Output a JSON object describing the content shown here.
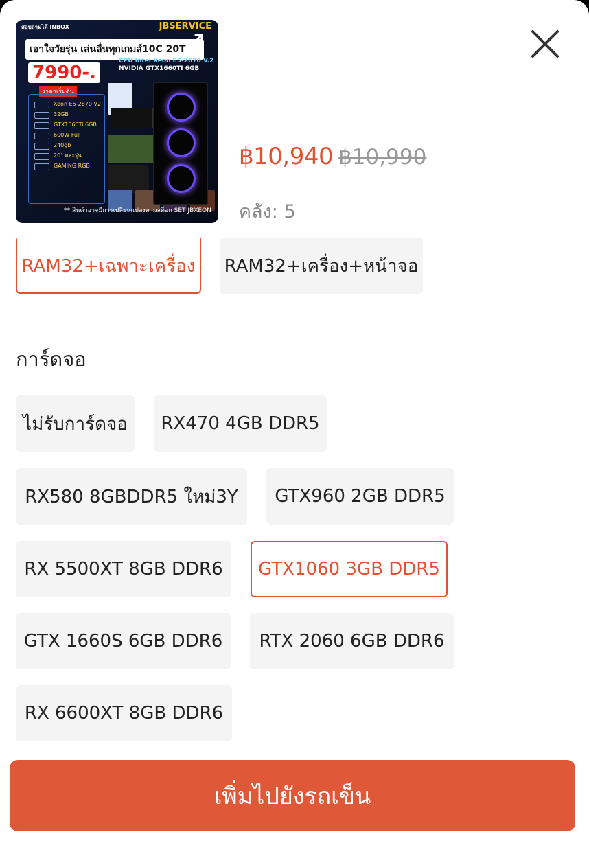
{
  "product": {
    "price": "฿10,940",
    "original_price": "฿10,990",
    "stock_label": "คลัง: 5",
    "image": {
      "top_badge": "สอบถามได้ INBOX",
      "brand": "JBSERVICE",
      "banner_text": "เอาใจวัยรุ่น เล่นลื่นทุกเกมส์10C 20T",
      "promo_price": "7990-.",
      "promo_sub": "ราคาเริ่มต้น",
      "cpu_text": "CPU Intel Xeon E5-2670 V.2",
      "gpu_text": "NVIDIA GTX1660TI 6GB",
      "spec_rows": [
        "Xeon E5-2670 V2",
        "32GB",
        "GTX1660Ti 6GB",
        "600W Full",
        "240gb",
        "20\" คละรุ่น",
        "GAMING RGB"
      ],
      "footer_note": "** สินค้าอาจมีการเปลี่ยนแปลงตามสต็อก   SET JBXEON"
    }
  },
  "ram_options": [
    {
      "label": "RAM32+เฉพาะเครื่อง",
      "selected": true
    },
    {
      "label": "RAM32+เครื่อง+หน้าจอ",
      "selected": false
    }
  ],
  "gpu_section": {
    "title": "การ์ดจอ",
    "options": [
      {
        "label": "ไม่รับการ์ดจอ",
        "selected": false
      },
      {
        "label": "RX470 4GB DDR5",
        "selected": false
      },
      {
        "label": "RX580 8GBDDR5 ใหม่3Y",
        "selected": false
      },
      {
        "label": "GTX960 2GB DDR5",
        "selected": false
      },
      {
        "label": "RX 5500XT 8GB DDR6",
        "selected": false
      },
      {
        "label": "GTX1060 3GB DDR5",
        "selected": true
      },
      {
        "label": "GTX 1660S 6GB DDR6",
        "selected": false
      },
      {
        "label": "RTX 2060 6GB DDR6",
        "selected": false
      },
      {
        "label": "RX 6600XT 8GB DDR6",
        "selected": false
      }
    ]
  },
  "actions": {
    "add_to_cart": "เพิ่มไปยังรถเข็น"
  },
  "icons": {
    "close": "close-icon",
    "expand": "expand-icon"
  },
  "colors": {
    "accent": "#e5502f",
    "button": "#df5838",
    "chip_bg": "#f4f4f4"
  }
}
